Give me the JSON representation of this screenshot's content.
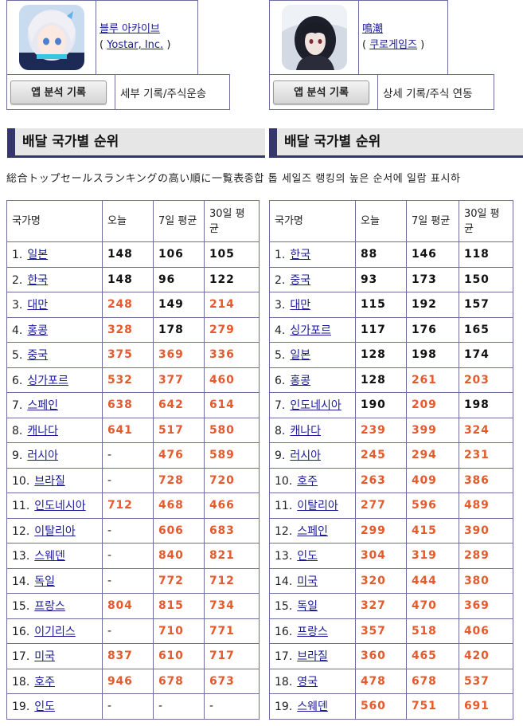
{
  "colors": {
    "link": "#1a1a99",
    "accent": "#36366e",
    "border": "#6d6d9e",
    "rank_good": "#111111",
    "rank_bad": "#e55a2c"
  },
  "left": {
    "app_name": "블루 아카이브",
    "publisher": "Yostar, Inc.",
    "button_label": "앱 분석 기록",
    "sub_label": "세부 기록/주식운송",
    "section_title": "배달 국가별 순위",
    "headers": {
      "country": "국가명",
      "today": "오늘",
      "avg7": "7일 평균",
      "avg30": "30일 평균"
    },
    "rows": [
      {
        "rank": "1.",
        "country": "일본",
        "today": "148",
        "avg7": "106",
        "avg30": "105",
        "today_color": "black",
        "avg7_color": "black",
        "avg30_color": "black"
      },
      {
        "rank": "2.",
        "country": "한국",
        "today": "148",
        "avg7": "96",
        "avg30": "122",
        "today_color": "black",
        "avg7_color": "black",
        "avg30_color": "black"
      },
      {
        "rank": "3.",
        "country": "대만",
        "today": "248",
        "avg7": "149",
        "avg30": "214",
        "today_color": "orange",
        "avg7_color": "black",
        "avg30_color": "orange"
      },
      {
        "rank": "4.",
        "country": "홍콩",
        "today": "328",
        "avg7": "178",
        "avg30": "279",
        "today_color": "orange",
        "avg7_color": "black",
        "avg30_color": "orange"
      },
      {
        "rank": "5.",
        "country": "중국",
        "today": "375",
        "avg7": "369",
        "avg30": "336",
        "today_color": "orange",
        "avg7_color": "orange",
        "avg30_color": "orange"
      },
      {
        "rank": "6.",
        "country": "싱가포르",
        "today": "532",
        "avg7": "377",
        "avg30": "460",
        "today_color": "orange",
        "avg7_color": "orange",
        "avg30_color": "orange"
      },
      {
        "rank": "7.",
        "country": "스페인",
        "today": "638",
        "avg7": "642",
        "avg30": "614",
        "today_color": "orange",
        "avg7_color": "orange",
        "avg30_color": "orange"
      },
      {
        "rank": "8.",
        "country": "캐나다",
        "today": "641",
        "avg7": "517",
        "avg30": "580",
        "today_color": "orange",
        "avg7_color": "orange",
        "avg30_color": "orange"
      },
      {
        "rank": "9.",
        "country": "러시아",
        "today": "-",
        "avg7": "476",
        "avg30": "589",
        "today_color": "plain",
        "avg7_color": "orange",
        "avg30_color": "orange"
      },
      {
        "rank": "10.",
        "country": "브라질",
        "today": "-",
        "avg7": "728",
        "avg30": "720",
        "today_color": "plain",
        "avg7_color": "orange",
        "avg30_color": "orange"
      },
      {
        "rank": "11.",
        "country": "인도네시아",
        "today": "712",
        "avg7": "468",
        "avg30": "466",
        "today_color": "orange",
        "avg7_color": "orange",
        "avg30_color": "orange"
      },
      {
        "rank": "12.",
        "country": "이탈리아",
        "today": "-",
        "avg7": "606",
        "avg30": "683",
        "today_color": "plain",
        "avg7_color": "orange",
        "avg30_color": "orange"
      },
      {
        "rank": "13.",
        "country": "스웨덴",
        "today": "-",
        "avg7": "840",
        "avg30": "821",
        "today_color": "plain",
        "avg7_color": "orange",
        "avg30_color": "orange"
      },
      {
        "rank": "14.",
        "country": "독일",
        "today": "-",
        "avg7": "772",
        "avg30": "712",
        "today_color": "plain",
        "avg7_color": "orange",
        "avg30_color": "orange"
      },
      {
        "rank": "15.",
        "country": "프랑스",
        "today": "804",
        "avg7": "815",
        "avg30": "734",
        "today_color": "orange",
        "avg7_color": "orange",
        "avg30_color": "orange"
      },
      {
        "rank": "16.",
        "country": "이기리스",
        "today": "-",
        "avg7": "710",
        "avg30": "771",
        "today_color": "plain",
        "avg7_color": "orange",
        "avg30_color": "orange"
      },
      {
        "rank": "17.",
        "country": "미국",
        "today": "837",
        "avg7": "610",
        "avg30": "717",
        "today_color": "orange",
        "avg7_color": "orange",
        "avg30_color": "orange"
      },
      {
        "rank": "18.",
        "country": "호주",
        "today": "946",
        "avg7": "678",
        "avg30": "673",
        "today_color": "orange",
        "avg7_color": "orange",
        "avg30_color": "orange"
      },
      {
        "rank": "19.",
        "country": "인도",
        "today": "-",
        "avg7": "-",
        "avg30": "-",
        "today_color": "plain",
        "avg7_color": "plain",
        "avg30_color": "plain"
      }
    ]
  },
  "right": {
    "app_name": "鳴潮",
    "publisher": "쿠로게임즈",
    "button_label": "앱 분석 기록",
    "sub_label": "상세 기록/주식 연동",
    "section_title": "배달 국가별 순위",
    "headers": {
      "country": "국가명",
      "today": "오늘",
      "avg7": "7일 평균",
      "avg30": "30일 평균"
    },
    "rows": [
      {
        "rank": "1.",
        "country": "한국",
        "today": "88",
        "avg7": "146",
        "avg30": "118",
        "today_color": "black",
        "avg7_color": "black",
        "avg30_color": "black"
      },
      {
        "rank": "2.",
        "country": "중국",
        "today": "93",
        "avg7": "173",
        "avg30": "150",
        "today_color": "black",
        "avg7_color": "black",
        "avg30_color": "black"
      },
      {
        "rank": "3.",
        "country": "대만",
        "today": "115",
        "avg7": "192",
        "avg30": "157",
        "today_color": "black",
        "avg7_color": "black",
        "avg30_color": "black"
      },
      {
        "rank": "4.",
        "country": "싱가포르",
        "today": "117",
        "avg7": "176",
        "avg30": "165",
        "today_color": "black",
        "avg7_color": "black",
        "avg30_color": "black"
      },
      {
        "rank": "5.",
        "country": "일본",
        "today": "128",
        "avg7": "198",
        "avg30": "174",
        "today_color": "black",
        "avg7_color": "black",
        "avg30_color": "black"
      },
      {
        "rank": "6.",
        "country": "홍콩",
        "today": "128",
        "avg7": "261",
        "avg30": "203",
        "today_color": "black",
        "avg7_color": "orange",
        "avg30_color": "orange"
      },
      {
        "rank": "7.",
        "country": "인도네시아",
        "today": "190",
        "avg7": "209",
        "avg30": "198",
        "today_color": "black",
        "avg7_color": "orange",
        "avg30_color": "black"
      },
      {
        "rank": "8.",
        "country": "캐나다",
        "today": "239",
        "avg7": "399",
        "avg30": "324",
        "today_color": "orange",
        "avg7_color": "orange",
        "avg30_color": "orange"
      },
      {
        "rank": "9.",
        "country": "러시아",
        "today": "245",
        "avg7": "294",
        "avg30": "231",
        "today_color": "orange",
        "avg7_color": "orange",
        "avg30_color": "orange"
      },
      {
        "rank": "10.",
        "country": "호주",
        "today": "263",
        "avg7": "409",
        "avg30": "386",
        "today_color": "orange",
        "avg7_color": "orange",
        "avg30_color": "orange"
      },
      {
        "rank": "11.",
        "country": "이탈리아",
        "today": "277",
        "avg7": "596",
        "avg30": "489",
        "today_color": "orange",
        "avg7_color": "orange",
        "avg30_color": "orange"
      },
      {
        "rank": "12.",
        "country": "스페인",
        "today": "299",
        "avg7": "415",
        "avg30": "390",
        "today_color": "orange",
        "avg7_color": "orange",
        "avg30_color": "orange"
      },
      {
        "rank": "13.",
        "country": "인도",
        "today": "304",
        "avg7": "319",
        "avg30": "289",
        "today_color": "orange",
        "avg7_color": "orange",
        "avg30_color": "orange"
      },
      {
        "rank": "14.",
        "country": "미국",
        "today": "320",
        "avg7": "444",
        "avg30": "380",
        "today_color": "orange",
        "avg7_color": "orange",
        "avg30_color": "orange"
      },
      {
        "rank": "15.",
        "country": "독일",
        "today": "327",
        "avg7": "470",
        "avg30": "369",
        "today_color": "orange",
        "avg7_color": "orange",
        "avg30_color": "orange"
      },
      {
        "rank": "16.",
        "country": "프랑스",
        "today": "357",
        "avg7": "518",
        "avg30": "406",
        "today_color": "orange",
        "avg7_color": "orange",
        "avg30_color": "orange"
      },
      {
        "rank": "17.",
        "country": "브라질",
        "today": "360",
        "avg7": "465",
        "avg30": "420",
        "today_color": "orange",
        "avg7_color": "orange",
        "avg30_color": "orange"
      },
      {
        "rank": "18.",
        "country": "영국",
        "today": "478",
        "avg7": "678",
        "avg30": "537",
        "today_color": "orange",
        "avg7_color": "orange",
        "avg30_color": "orange"
      },
      {
        "rank": "19.",
        "country": "스웨덴",
        "today": "560",
        "avg7": "751",
        "avg30": "691",
        "today_color": "orange",
        "avg7_color": "orange",
        "avg30_color": "orange"
      }
    ]
  },
  "description": "総合トップセールスランキングの高い順に一覧表종합 톱 세일즈 랭킹의 높은 순서에 일람 표시하"
}
